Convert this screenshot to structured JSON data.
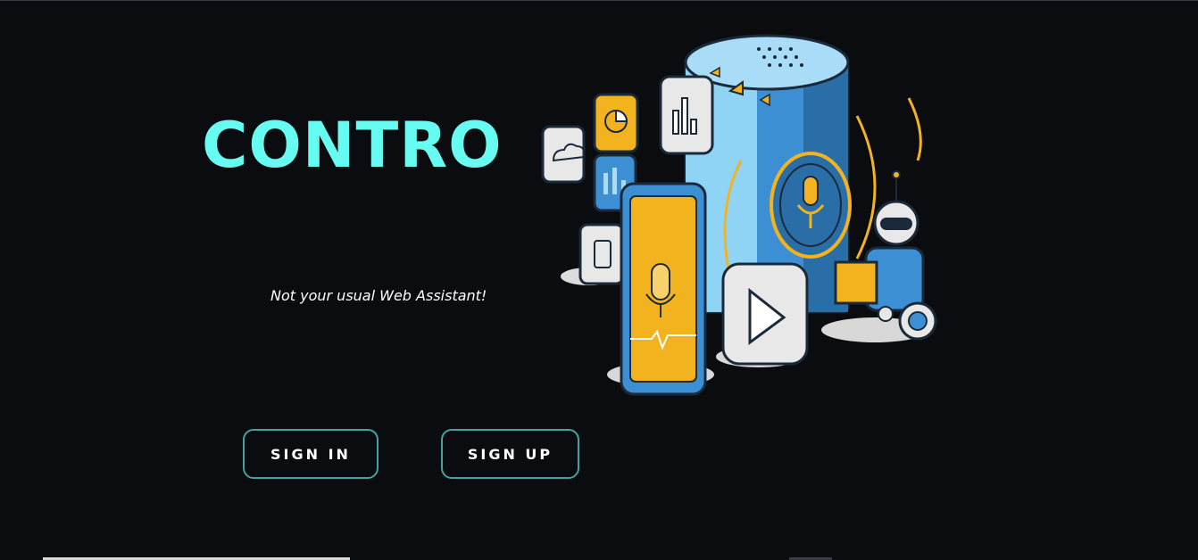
{
  "brand": {
    "title": "CONTRO"
  },
  "hero": {
    "tagline": "Not your usual Web Assistant!"
  },
  "actions": {
    "sign_in_label": "SIGN IN",
    "sign_up_label": "SIGN UP"
  },
  "colors": {
    "background": "#0b0c10",
    "accent": "#66fcf1",
    "button_border": "#45a29e",
    "illustration_blue": "#3d8fd4",
    "illustration_yellow": "#f2b31f"
  },
  "illustration": {
    "icons": [
      "cloud-icon",
      "pie-chart-icon",
      "bar-chart-icon",
      "tablet-icon",
      "microphone-icon",
      "play-icon",
      "robot-icon",
      "smart-speaker-icon",
      "smartphone-icon"
    ]
  }
}
